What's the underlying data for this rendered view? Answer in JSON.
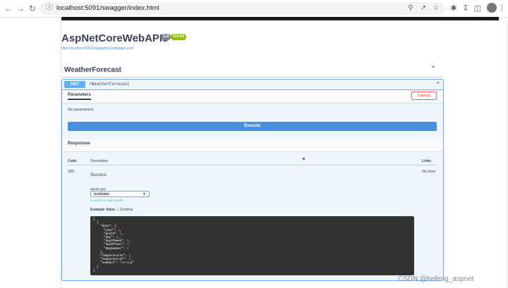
{
  "browser": {
    "url": "localhost:5091/swagger/index.html",
    "nav_icons": [
      "back-arrow-icon",
      "forward-arrow-icon",
      "reload-icon"
    ],
    "right_icons": [
      "zoom-icon",
      "share-icon",
      "star-icon",
      "extensions-icon",
      "download-icon",
      "sidepanel-icon"
    ]
  },
  "api": {
    "title": "AspNetCoreWebAPI8",
    "version_badge": "1.0",
    "oas_badge": "OAS3",
    "spec_link": "http://localhost:5091/swagger/v1/swagger.json"
  },
  "tag": {
    "name": "WeatherForecast"
  },
  "operation": {
    "method": "GET",
    "path": "/WeatherForecast",
    "parameters_tab": "Parameters",
    "cancel_label": "Cancel",
    "no_params": "No parameters",
    "execute_label": "Execute",
    "responses_title": "Responses",
    "columns": {
      "code": "Code",
      "description": "Description",
      "links": "Links"
    },
    "response": {
      "code": "200",
      "description": "Success",
      "links": "No links",
      "media_type_label": "Media type",
      "media_type_value": "text/plain",
      "media_type_hint": "Controls Accept header.",
      "example_tab": "Example Value",
      "schema_tab": "Schema"
    }
  },
  "example_json": {
    "date_key": "\"date\"",
    "year_key": "\"year\"",
    "month_key": "\"month\"",
    "day_key": "\"day\"",
    "dayOfWeek_key": "\"dayOfWeek\"",
    "dayOfYear_key": "\"dayOfYear\"",
    "dayNumber_key": "\"dayNumber\"",
    "temperatureC_key": "\"temperatureC\"",
    "temperatureF_key": "\"temperatureF\"",
    "summary_key": "\"summary\"",
    "zero": "0",
    "string_value": "\"string\""
  },
  "watermark": "CSDN @hefeng_aspnet",
  "colors": {
    "get_blue": "#61affe",
    "execute_blue": "#4990e2",
    "cancel_red": "#ff6060",
    "oas_green": "#89bf04",
    "media_green": "#49cc90"
  }
}
